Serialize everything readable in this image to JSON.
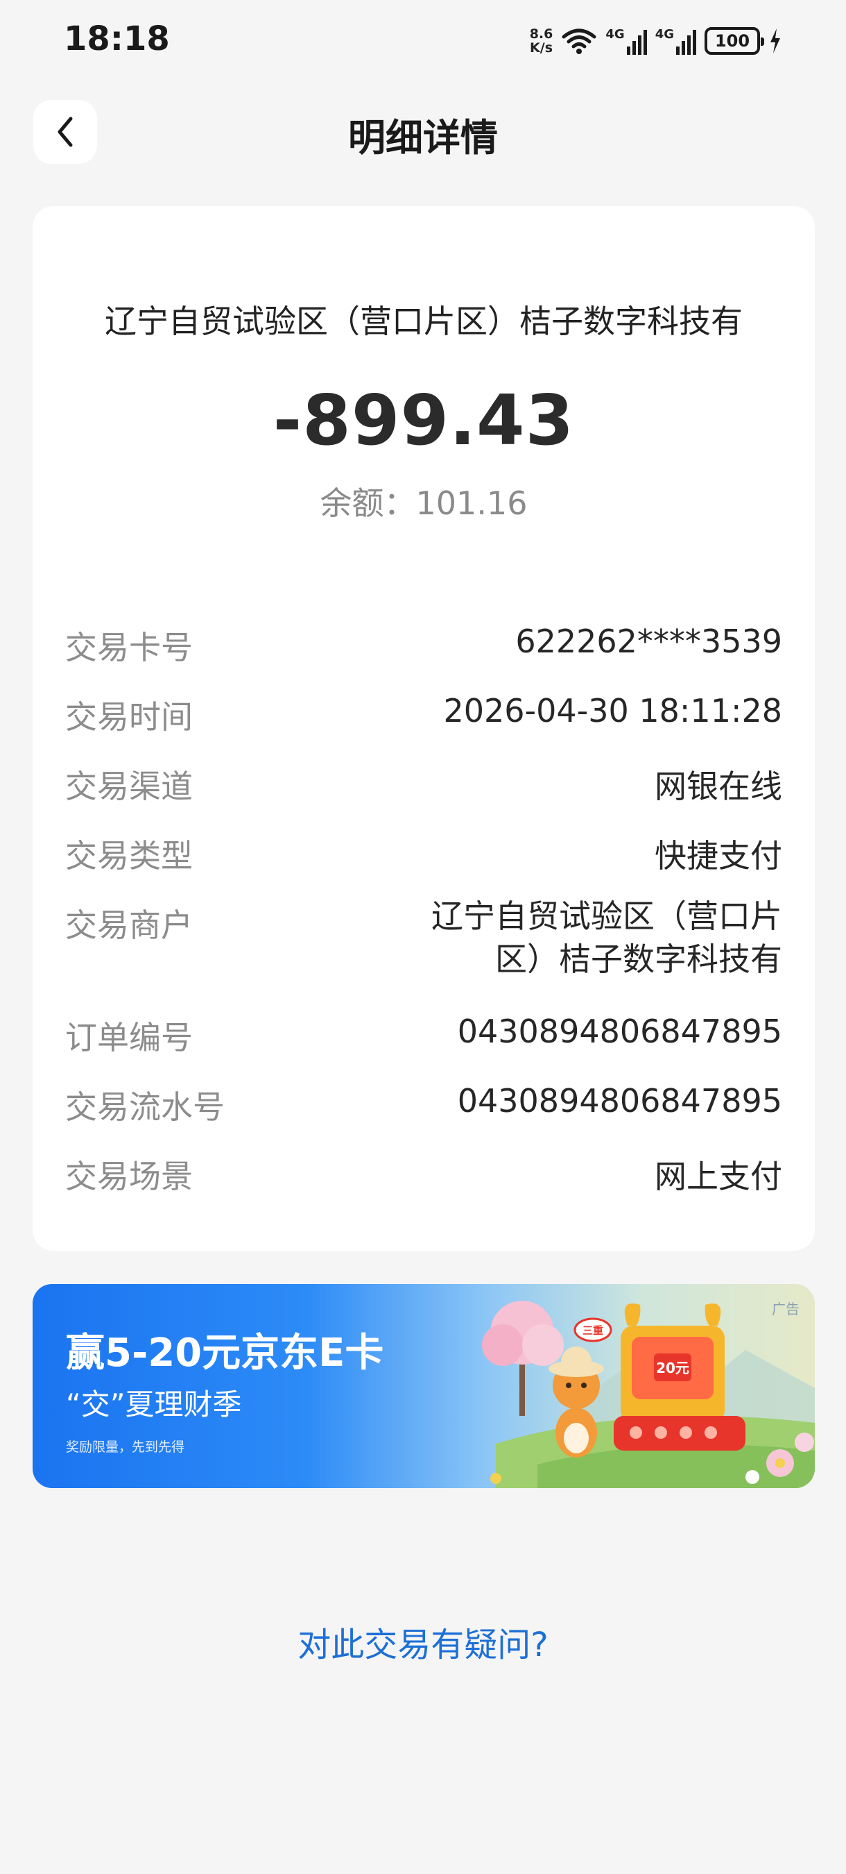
{
  "status_bar": {
    "time": "18:18",
    "net_speed_value": "8.6",
    "net_speed_unit": "K/s",
    "network_1": "4G",
    "network_2": "4G",
    "battery": "100",
    "icons": [
      "wifi-icon",
      "signal-icon",
      "signal-icon",
      "battery-icon",
      "charging-icon"
    ]
  },
  "header": {
    "title": "明细详情",
    "back_icon": "chevron-left-icon"
  },
  "transaction": {
    "merchant_title": "辽宁自贸试验区（营口片区）桔子数字科技有",
    "amount": "-899.43",
    "balance": "余额：101.16"
  },
  "details": [
    {
      "label": "交易卡号",
      "value": "622262****3539"
    },
    {
      "label": "交易时间",
      "value": "2026-04-30 18:11:28"
    },
    {
      "label": "交易渠道",
      "value": "网银在线"
    },
    {
      "label": "交易类型",
      "value": "快捷支付"
    },
    {
      "label": "交易商户",
      "value": "辽宁自贸试验区（营口片区）桔子数字科技有"
    },
    {
      "label": "订单编号",
      "value": "0430894806847895"
    },
    {
      "label": "交易流水号",
      "value": "0430894806847895"
    },
    {
      "label": "交易场景",
      "value": "网上支付"
    }
  ],
  "banner": {
    "ad_tag": "广告",
    "title": "赢5-20元京东E卡",
    "subtitle": "“交”夏理财季",
    "note": "奖励限量，先到先得",
    "badge_text": "三重",
    "coupon_text": "20元"
  },
  "footer": {
    "query_link": "对此交易有疑问?"
  },
  "colors": {
    "page_background": "#f5f5f5",
    "card_background": "#ffffff",
    "link_blue": "#1d6fd6",
    "banner_blue": "#1a74f0"
  }
}
